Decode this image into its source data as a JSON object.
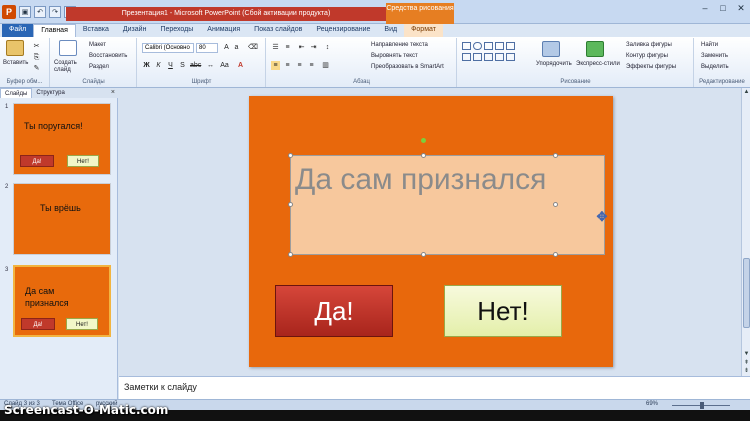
{
  "window": {
    "title": "Презентация1 - Microsoft PowerPoint (Сбой активации продукта)",
    "context_tab_group": "Средства рисования",
    "app_letter": "P"
  },
  "tabs": [
    "Файл",
    "Главная",
    "Вставка",
    "Дизайн",
    "Переходы",
    "Анимация",
    "Показ слайдов",
    "Рецензирование",
    "Вид",
    "Формат"
  ],
  "ribbon": {
    "clipboard": {
      "paste": "Вставить",
      "label": "Буфер обм..."
    },
    "slides": {
      "new_slide": "Создать слайд",
      "layout": "Макет",
      "reset": "Восстановить",
      "section": "Раздел",
      "label": "Слайды"
    },
    "font": {
      "font_name": "Calibri (Основно",
      "font_size": "80",
      "label": "Шрифт"
    },
    "paragraph": {
      "text_direction": "Направление текста",
      "align_text": "Выровнять текст",
      "smartart": "Преобразовать в SmartArt",
      "label": "Абзац"
    },
    "drawing": {
      "arrange": "Упорядочить",
      "quick_styles": "Экспресс-стили",
      "shape_fill": "Заливка фигуры",
      "shape_outline": "Контур фигуры",
      "shape_effects": "Эффекты фигуры",
      "label": "Рисование"
    },
    "editing": {
      "find": "Найти",
      "replace": "Заменить",
      "select": "Выделить",
      "label": "Редактирование"
    }
  },
  "panel": {
    "tabs": [
      "Слайды",
      "Структура"
    ],
    "close": "×"
  },
  "slides": [
    {
      "num": "1",
      "text": "Ты поругался!",
      "yes": "Да!",
      "no": "Нет!"
    },
    {
      "num": "2",
      "text": "Ты врёшь"
    },
    {
      "num": "3",
      "text": "Да сам признался",
      "yes": "Да!",
      "no": "Нет!"
    }
  ],
  "main_slide": {
    "textbox": "Да сам признался",
    "yes_button": "Да!",
    "no_button": "Нет!"
  },
  "notes": {
    "placeholder": "Заметки к слайду"
  },
  "status": {
    "slide_info": "Слайд 3 из 3",
    "theme": "Тема Office",
    "language": "русский",
    "zoom": "69%"
  },
  "watermark": "Screencast-O-Matic.com",
  "colors": {
    "slide_bg": "#e8680c",
    "yes_button": "#c0392b",
    "no_button": "#f2f7c8",
    "textbox_fill": "#f7c89d"
  }
}
